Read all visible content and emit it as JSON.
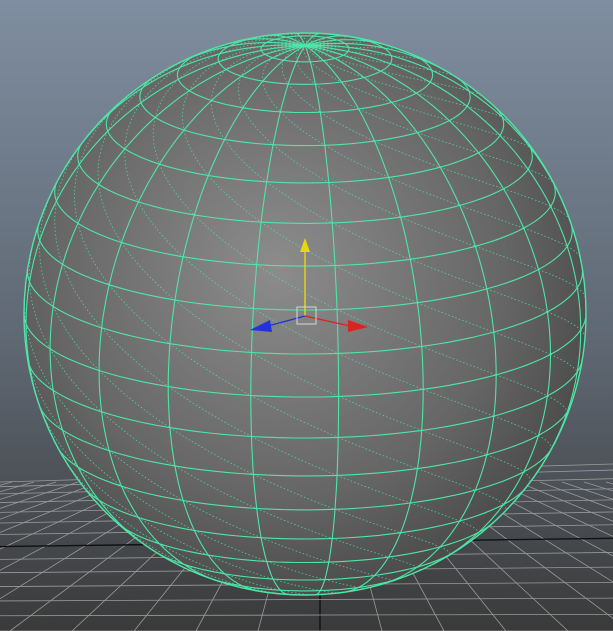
{
  "viewport": {
    "background_top_color": "#7f8ea0",
    "background_bottom_color": "#3a3a3a",
    "grid_color": "#9a9a9a",
    "grid_axis_color": "#111111"
  },
  "sphere": {
    "selected": true,
    "shading_light_color": "#8c8c8c",
    "shading_dark_color": "#474747",
    "wireframe_color": "#4fe5a8",
    "latitude_divisions": 20,
    "longitude_divisions": 20
  },
  "manipulator": {
    "type": "move",
    "x_axis_color": "#dd2222",
    "y_axis_color": "#e8d612",
    "z_axis_color": "#2233dd",
    "center_color": "#d8d8d8"
  }
}
